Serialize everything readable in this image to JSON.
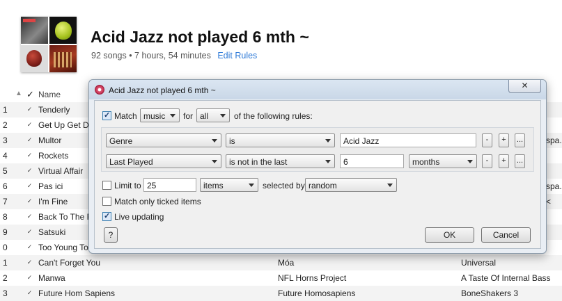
{
  "playlist": {
    "title": "Acid Jazz not played 6 mth ~",
    "stats": "92 songs • 7 hours, 54 minutes",
    "edit_rules": "Edit Rules"
  },
  "table": {
    "header": {
      "check": "✓",
      "name": "Name"
    },
    "rows": [
      {
        "num": "1",
        "name": "Tenderly",
        "artist": "",
        "album": "",
        "right": ""
      },
      {
        "num": "2",
        "name": "Get Up Get Down",
        "artist": "",
        "album": "",
        "right": ""
      },
      {
        "num": "3",
        "name": "Multor",
        "artist": "",
        "album": "",
        "right": "spa."
      },
      {
        "num": "4",
        "name": "Rockets",
        "artist": "",
        "album": "",
        "right": ""
      },
      {
        "num": "5",
        "name": "Virtual Affair",
        "artist": "",
        "album": "",
        "right": ""
      },
      {
        "num": "6",
        "name": "Pas ici",
        "artist": "",
        "album": "",
        "right": "spa."
      },
      {
        "num": "7",
        "name": "I'm Fine",
        "artist": "",
        "album": "",
        "right": "<"
      },
      {
        "num": "8",
        "name": "Back To The F",
        "artist": "",
        "album": "",
        "right": ""
      },
      {
        "num": "9",
        "name": "Satsuki",
        "artist": "",
        "album": "",
        "right": ""
      },
      {
        "num": "0",
        "name": "Too Young To",
        "artist": "",
        "album": "",
        "right": ""
      },
      {
        "num": "1",
        "name": "Can't Forget You",
        "artist": "Móa",
        "album": "Universal",
        "right": ""
      },
      {
        "num": "2",
        "name": "Manwa",
        "artist": "NFL Horns Project",
        "album": "A Taste Of Internal Bass",
        "right": ""
      },
      {
        "num": "3",
        "name": "Future Hom Sapiens",
        "artist": "Future Homosapiens",
        "album": "BoneShakers 3",
        "right": ""
      }
    ]
  },
  "dialog": {
    "title": "Acid Jazz not played 6 mth ~",
    "close": "✕",
    "match_label": "Match",
    "match_kind": "music",
    "for_label": "for",
    "match_scope": "all",
    "of_rules": "of the following rules:",
    "rules": [
      {
        "field": "Genre",
        "operator": "is",
        "value": "Acid Jazz"
      },
      {
        "field": "Last Played",
        "operator": "is not in the last",
        "value": "6",
        "unit": "months"
      }
    ],
    "rule_buttons": {
      "remove": "-",
      "add": "+",
      "more": "..."
    },
    "limit_label": "Limit to",
    "limit_value": "25",
    "limit_unit": "items",
    "selected_by_label": "selected by",
    "selected_by": "random",
    "ticked_label": "Match only ticked items",
    "live_label": "Live updating",
    "help": "?",
    "ok": "OK",
    "cancel": "Cancel",
    "checkboxes": {
      "match": true,
      "limit": false,
      "ticked": false,
      "live": true
    }
  }
}
